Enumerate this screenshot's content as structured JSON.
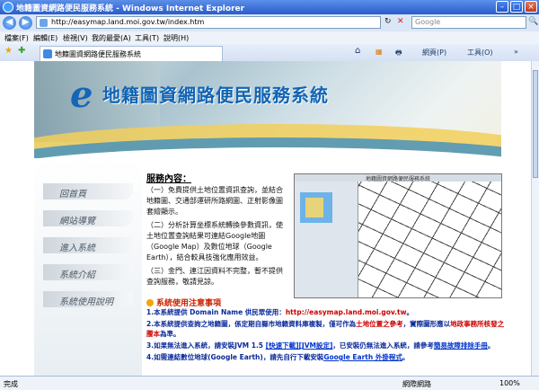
{
  "window": {
    "title": "地籍圖資網路便民服務系統 - Windows Internet Explorer",
    "minimize": "–",
    "maximize": "□",
    "close": "×"
  },
  "address": {
    "back": "◀",
    "forward": "▶",
    "url": "http://easymap.land.moi.gov.tw/index.htm",
    "refresh": "↻",
    "stop": "✕",
    "search_placeholder": "Google",
    "search_go": "🔍"
  },
  "menu": [
    "檔案(F)",
    "編輯(E)",
    "檢視(V)",
    "我的最愛(A)",
    "工具(T)",
    "說明(H)"
  ],
  "tab": {
    "label": "地籍圖資網路便民服務系統"
  },
  "toolbar": {
    "home": "⌂",
    "feeds": "▦",
    "print": "🖶",
    "page": "網頁(P)",
    "tools": "工具(O)",
    "extra": "»"
  },
  "banner": {
    "logo_e": "e",
    "title": "地籍圖資網路便民服務系統"
  },
  "nav": [
    "回首頁",
    "網站導覽",
    "進入系統",
    "系統介紹",
    "系統使用說明"
  ],
  "service": {
    "heading": "服務內容：",
    "items": [
      "（一）免費提供土地位置資訊查詢，並結合地籍圖、交通部運研所路網圖、正射影像圖套繪顯示。",
      "（二）分析計算坐標系統轉換參數資訊，使土地位置查詢結果可連結Google地圖（Google Map）及數位地球（Google Earth），結合較具技強化應用效益。",
      "（三）金門、連江因資料不完整，暫不提供查詢服務，敬請見諒。"
    ]
  },
  "map_preview": {
    "header": "地籍圖資網路便民服務系統"
  },
  "notice": {
    "heading": "系統使用注意事項",
    "n1_a": "1.本系統提供 Domain Name 供民眾使用：",
    "n1_url": "http://easymap.land.moi.gov.tw",
    "n1_end": "。",
    "n2_a": "2.本系統提供查詢之地籍圖，係定期自縣市地籍資料庫複製，僅可作為",
    "n2_red1": "土地位置之參考",
    "n2_b": "，實際圖形應以",
    "n2_red2": "地政事務所核發之謄本",
    "n2_c": "為準。",
    "n3_a": "3.如果無法進入系統，請安裝JVM 1.5 ",
    "n3_link1": "[快速下載]",
    "n3_link2": "[JVM設定]",
    "n3_b": "，已安裝仍無法進入系統，請參考",
    "n3_link3": "簡易故障排除手冊",
    "n3_c": "。",
    "n4_a": "4.如需連結數位地球(Google Earth)，請先自行下載安裝",
    "n4_link": "Google Earth 外掛程式",
    "n4_b": "。"
  },
  "status": {
    "left": "完成",
    "zone": "網際網路",
    "zoom": "100%"
  }
}
